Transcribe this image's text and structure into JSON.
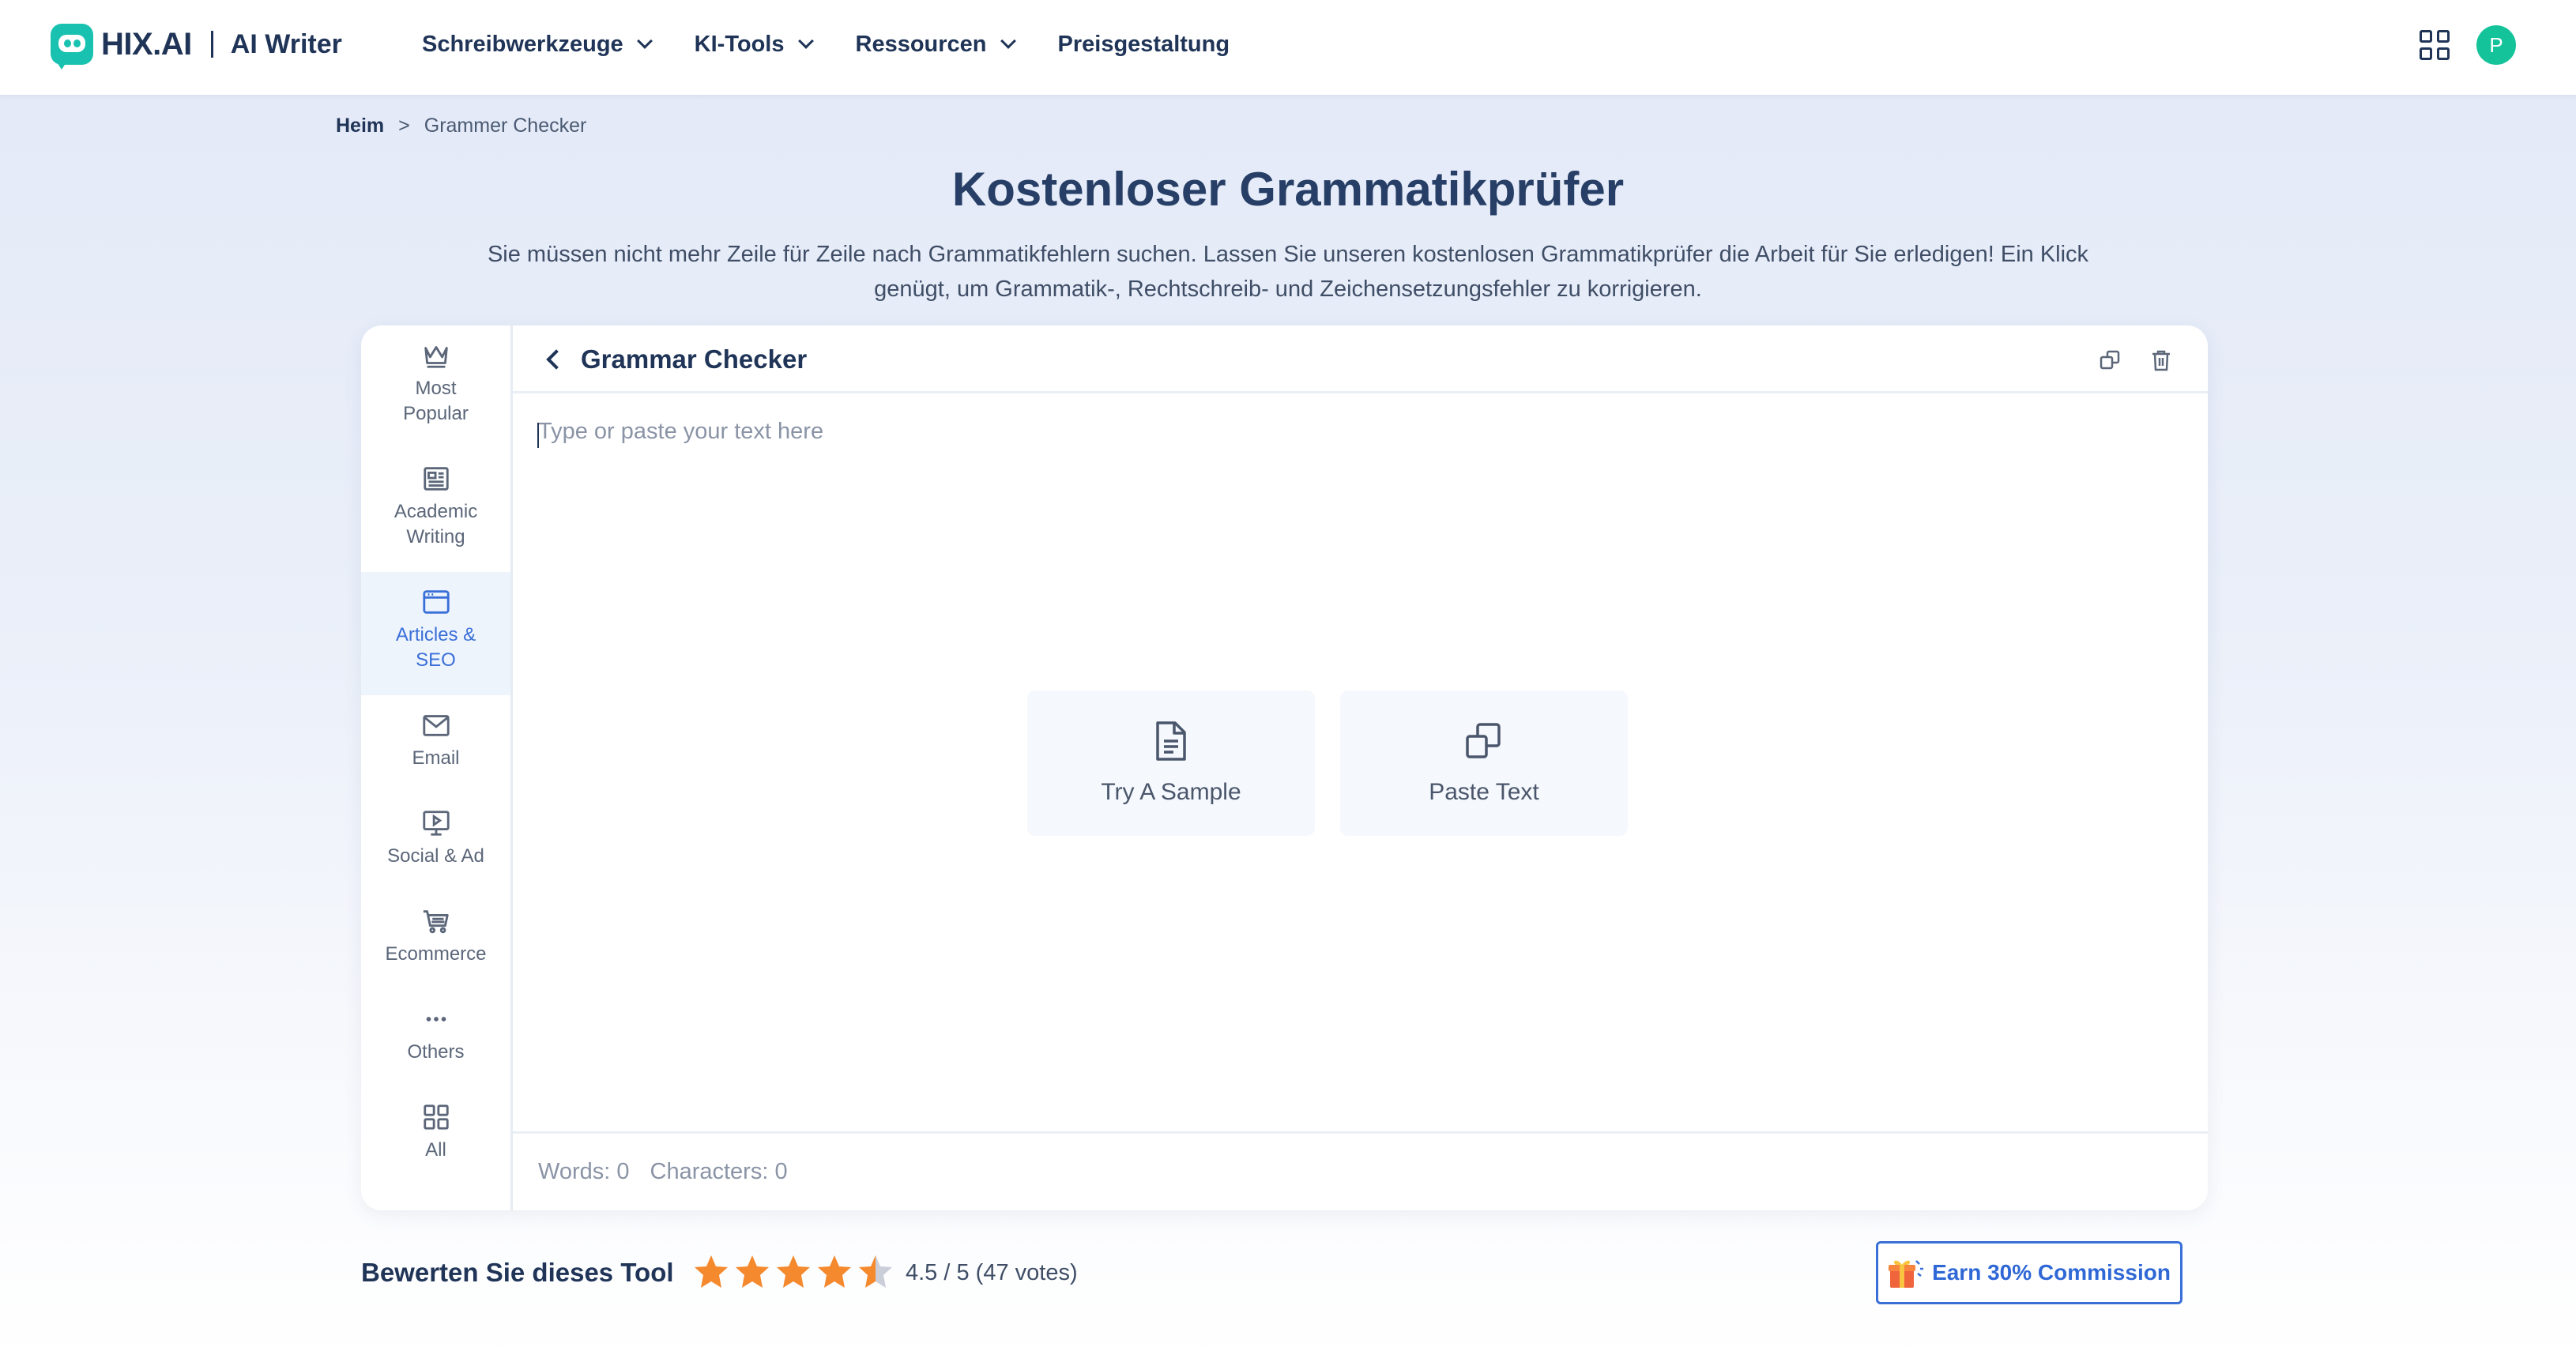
{
  "brand": {
    "name": "HIX.AI",
    "product": "AI Writer"
  },
  "nav": {
    "items": [
      {
        "label": "Schreibwerkzeuge",
        "dropdown": true
      },
      {
        "label": "KI-Tools",
        "dropdown": true
      },
      {
        "label": "Ressourcen",
        "dropdown": true
      },
      {
        "label": "Preisgestaltung",
        "dropdown": false
      }
    ],
    "apps_icon": "grid-icon",
    "avatar_initial": "P"
  },
  "breadcrumb": {
    "home": "Heim",
    "separator": ">",
    "current": "Grammer Checker"
  },
  "header": {
    "title": "Kostenloser Grammatikprüfer",
    "description_line1": "Sie müssen nicht mehr Zeile für Zeile nach Grammatikfehlern suchen. Lassen Sie unseren kostenlosen Grammatikprüfer die Arbeit für Sie erledigen! Ein Klick",
    "description_line2": "genügt, um Grammatik-, Rechtschreib- und Zeichensetzungsfehler zu korrigieren."
  },
  "sidebar": {
    "items": [
      {
        "line1": "Most",
        "line2": "Popular",
        "icon": "crown-icon",
        "active": false
      },
      {
        "line1": "Academic",
        "line2": "Writing",
        "icon": "newspaper-icon",
        "active": false
      },
      {
        "line1": "Articles &",
        "line2": "SEO",
        "icon": "browser-window-icon",
        "active": true
      },
      {
        "line1": "Email",
        "line2": "",
        "icon": "envelope-icon",
        "active": false
      },
      {
        "line1": "Social & Ad",
        "line2": "",
        "icon": "monitor-play-icon",
        "active": false
      },
      {
        "line1": "Ecommerce",
        "line2": "",
        "icon": "shopping-cart-icon",
        "active": false
      },
      {
        "line1": "Others",
        "line2": "",
        "icon": "more-dots-icon",
        "active": false
      },
      {
        "line1": "All",
        "line2": "",
        "icon": "grid-icon",
        "active": false
      }
    ]
  },
  "tool": {
    "title": "Grammar Checker",
    "placeholder": "Type or paste your text here",
    "value": "",
    "actions": {
      "sample": "Try A Sample",
      "paste": "Paste Text"
    },
    "words_label": "Words: 0",
    "chars_label": "Characters: 0"
  },
  "rating": {
    "label": "Bewerten Sie dieses Tool",
    "score": 4.5,
    "max": 5,
    "summary": "4.5 / 5 (47 votes)",
    "star_color": "#f5892e"
  },
  "commission": {
    "label": "Earn 30% Commission"
  },
  "colors": {
    "brand_teal": "#19c2b0",
    "accent_blue": "#3a6fd8",
    "avatar_green": "#15c39a",
    "heading_navy": "#273f66"
  }
}
